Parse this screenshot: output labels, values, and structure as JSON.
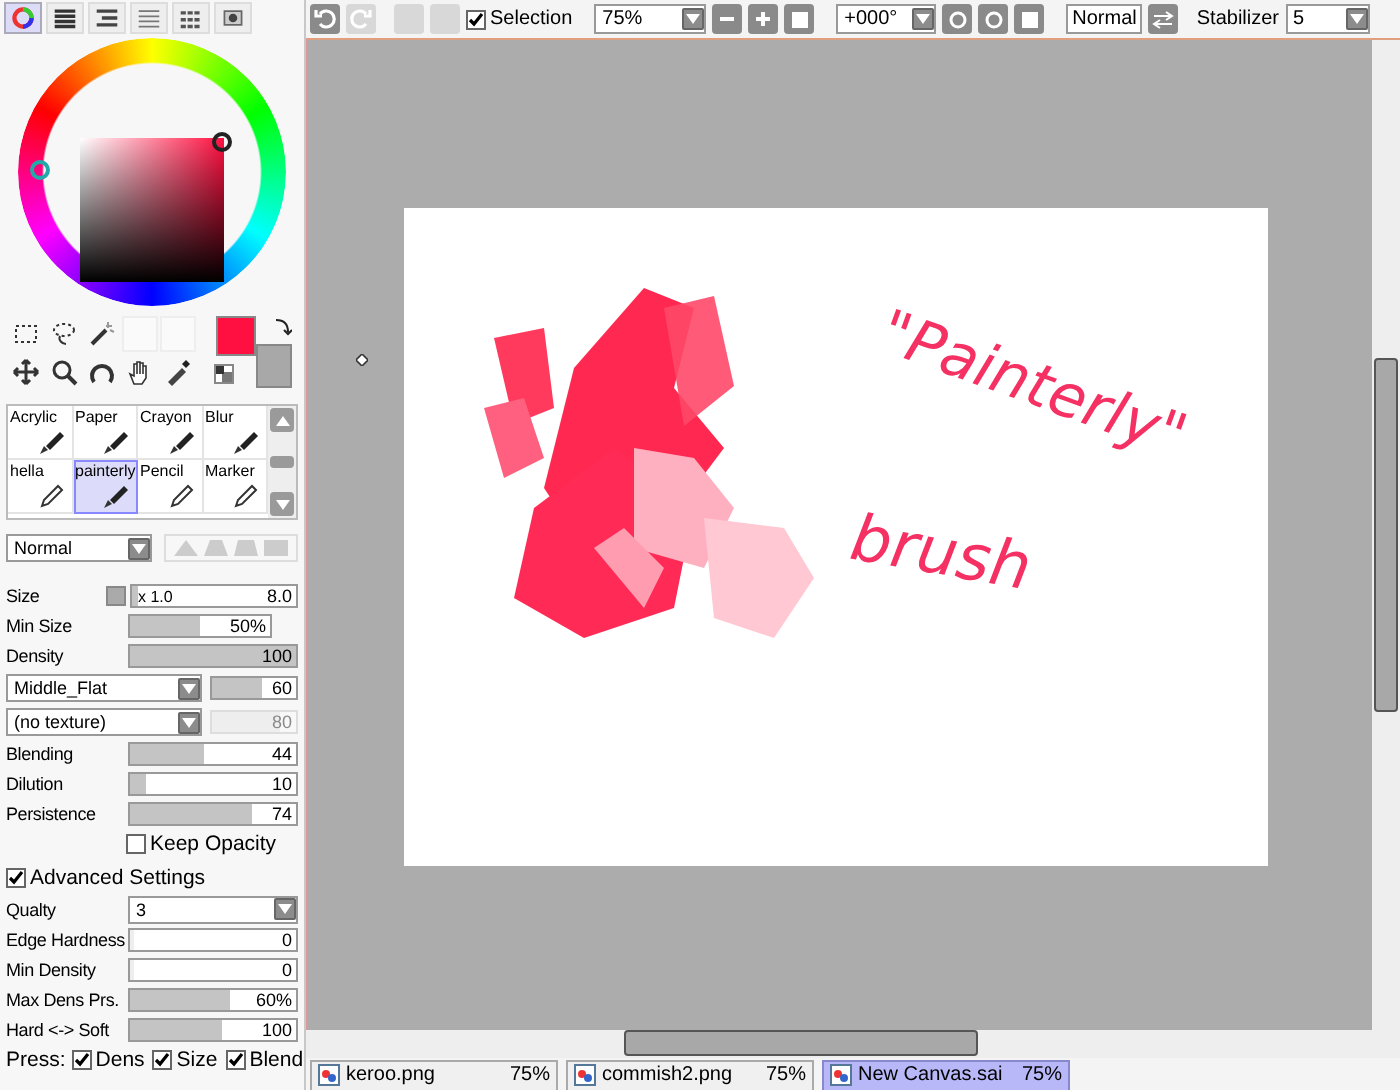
{
  "panel_tabs": [
    {
      "selected": true
    },
    {
      "selected": false
    },
    {
      "selected": false
    },
    {
      "selected": false
    },
    {
      "selected": false
    },
    {
      "selected": false
    }
  ],
  "brushes": [
    {
      "label": "Acrylic",
      "selected": false
    },
    {
      "label": "Paper",
      "selected": false
    },
    {
      "label": "Crayon",
      "selected": false
    },
    {
      "label": "Blur",
      "selected": false
    },
    {
      "label": "hella",
      "selected": false
    },
    {
      "label": "painterly",
      "selected": true
    },
    {
      "label": "Pencil",
      "selected": false
    },
    {
      "label": "Marker",
      "selected": false
    }
  ],
  "blend_mode": "Normal",
  "settings": [
    {
      "kind": "size",
      "label": "Size",
      "prefix": "x 1.0",
      "value": "8.0",
      "level": 0.04
    },
    {
      "kind": "short",
      "label": "Min Size",
      "value": "50%",
      "level": 0.5
    },
    {
      "kind": "slider",
      "label": "Density",
      "value": "100",
      "level": 1
    },
    {
      "kind": "combo",
      "select": "Middle_Flat",
      "value": "60",
      "level": 0.6,
      "disabled": false
    },
    {
      "kind": "combo",
      "select": "(no texture)",
      "value": "80",
      "level": 0.8,
      "disabled": true
    },
    {
      "kind": "slider",
      "label": "Blending",
      "value": "44",
      "level": 0.44
    },
    {
      "kind": "slider",
      "label": "Dilution",
      "value": "10",
      "level": 0.1
    },
    {
      "kind": "slider",
      "label": "Persistence",
      "value": "74",
      "level": 0.74
    },
    {
      "kind": "check",
      "label": "Keep Opacity",
      "checked": false
    },
    {
      "kind": "heading",
      "label": "Advanced Settings",
      "checked": true
    },
    {
      "kind": "select",
      "label": "Qualty",
      "value": "3"
    },
    {
      "kind": "slider",
      "label": "Edge Hardness",
      "value": "0",
      "level": 0
    },
    {
      "kind": "slider",
      "label": "Min Density",
      "value": "0",
      "level": 0
    },
    {
      "kind": "slider",
      "label": "Max Dens Prs.",
      "value": "60%",
      "level": 0.6
    },
    {
      "kind": "slider",
      "label": "Hard <-> Soft",
      "value": "100",
      "level": 0.55
    }
  ],
  "press": {
    "label": "Press:",
    "options": [
      {
        "label": "Dens",
        "checked": true
      },
      {
        "label": "Size",
        "checked": true
      },
      {
        "label": "Blend",
        "checked": true
      }
    ]
  },
  "toolbar": {
    "selection": {
      "label": "Selection",
      "checked": true
    },
    "zoom": "75%",
    "rotation": "+000°",
    "mode": "Normal",
    "stabilizer_label": "Stabilizer",
    "stabilizer": "5"
  },
  "artwork": {
    "line_1": "\"Painterly\"",
    "line_2": "brush"
  },
  "documents": [
    {
      "name": "keroo.png",
      "zoom": "75%",
      "selected": false
    },
    {
      "name": "commish2.png",
      "zoom": "75%",
      "selected": false
    },
    {
      "name": "New Canvas.sai",
      "zoom": "75%",
      "selected": true
    }
  ]
}
